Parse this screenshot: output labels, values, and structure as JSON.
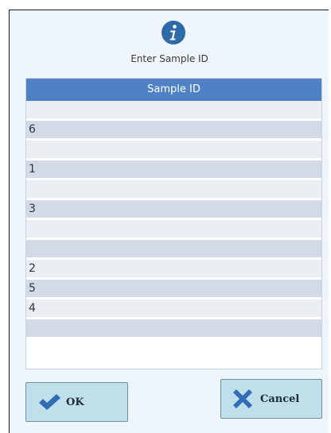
{
  "dialog": {
    "title": "Enter Sample ID",
    "icon": "info-icon"
  },
  "table": {
    "header": "Sample ID",
    "rows": [
      {
        "value": ""
      },
      {
        "value": "6"
      },
      {
        "value": ""
      },
      {
        "value": "1"
      },
      {
        "value": ""
      },
      {
        "value": "3"
      },
      {
        "value": ""
      },
      {
        "value": ""
      },
      {
        "value": "2"
      },
      {
        "value": "5"
      },
      {
        "value": "4"
      },
      {
        "value": ""
      }
    ]
  },
  "buttons": {
    "ok": {
      "label": "OK",
      "icon": "checkmark-icon"
    },
    "cancel": {
      "label": "Cancel",
      "icon": "x-icon"
    }
  },
  "colors": {
    "header": "#4f81c5",
    "row_light": "#e9eef2",
    "row_dark": "#d4dae5",
    "button_bg": "#bfe0ea",
    "check": "#2f6db5"
  }
}
